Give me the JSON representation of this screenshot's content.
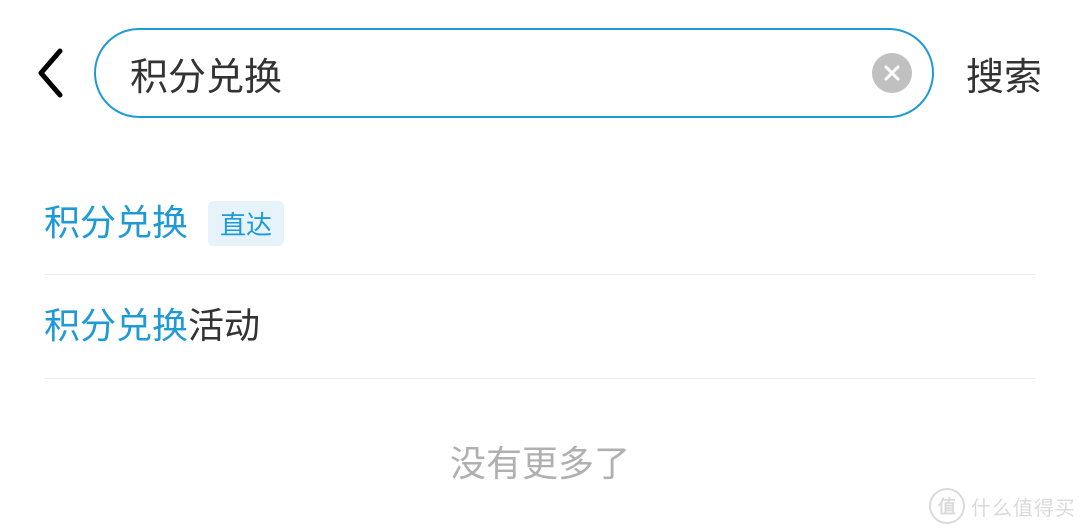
{
  "header": {
    "search_value": "积分兑换",
    "search_button_label": "搜索"
  },
  "results": [
    {
      "highlight": "积分兑换",
      "plain": "",
      "tag": "直达"
    },
    {
      "highlight": "积分兑换",
      "plain": "活动",
      "tag": ""
    }
  ],
  "footer": {
    "no_more": "没有更多了"
  },
  "watermark": {
    "glyph": "值",
    "text": "什么值得买"
  }
}
